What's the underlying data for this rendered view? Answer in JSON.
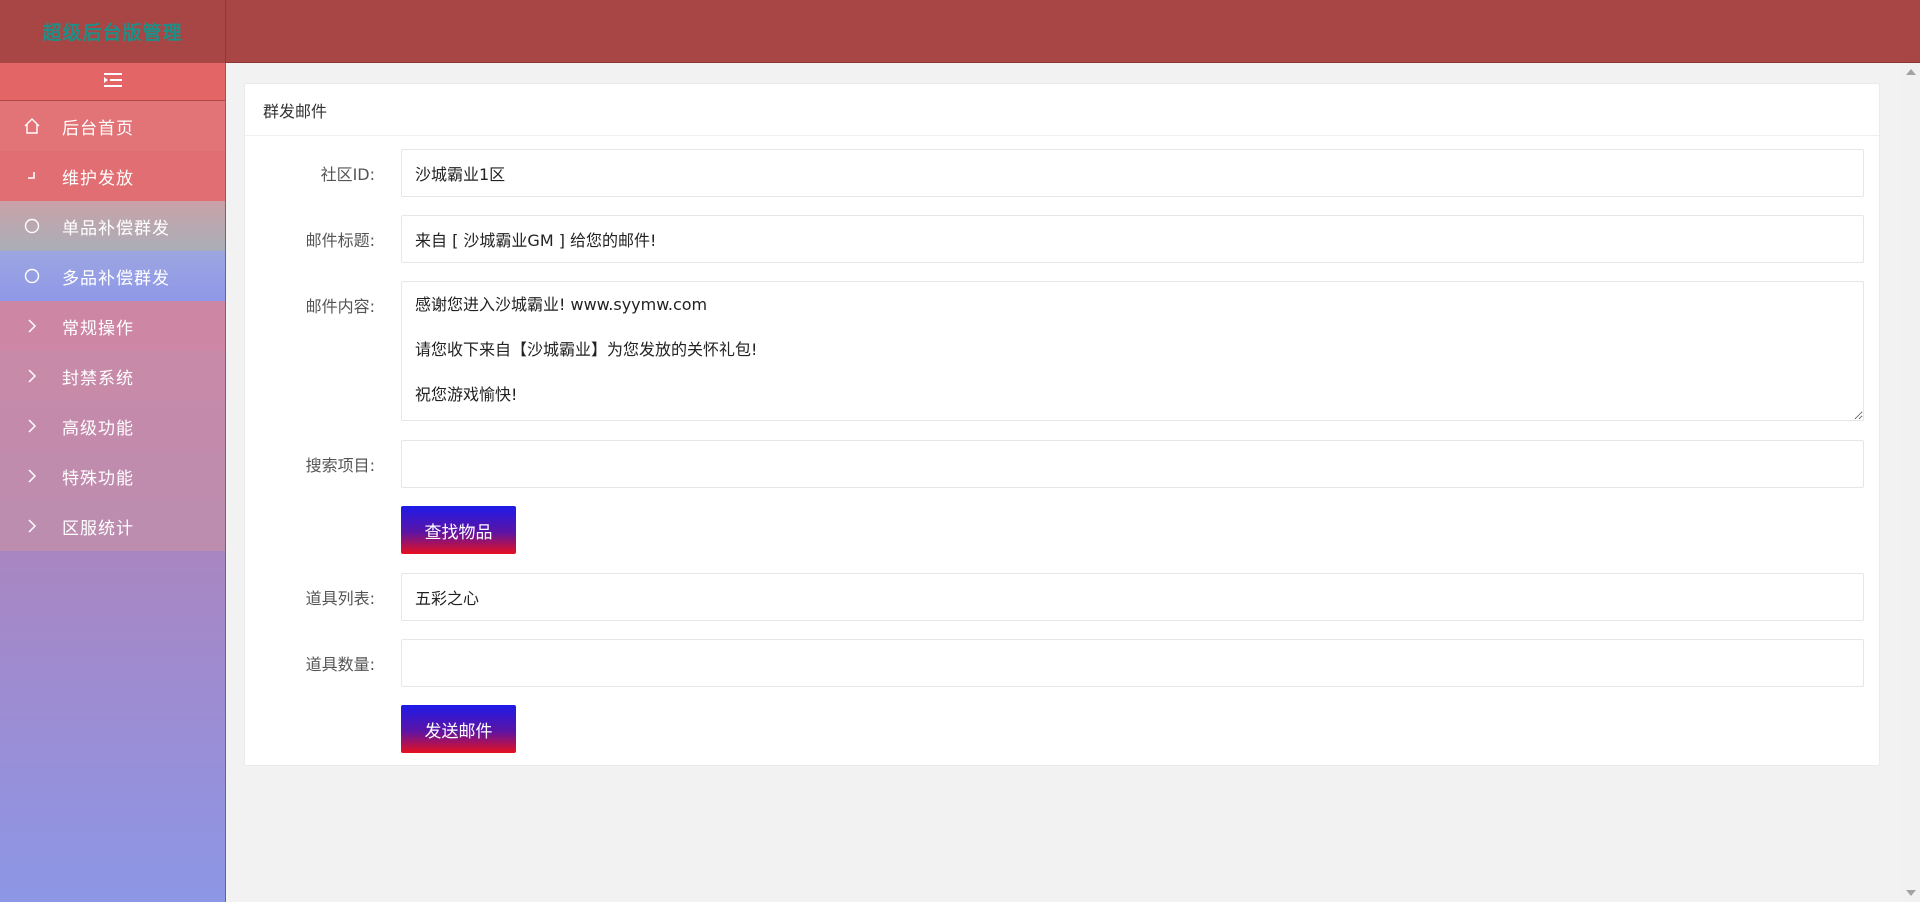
{
  "app": {
    "logo_text": "超级后台版管理"
  },
  "sidebar": {
    "toggle_icon": "menu-fold-icon",
    "items": [
      {
        "label": "后台首页",
        "icon": "home-icon"
      },
      {
        "label": "维护发放",
        "icon": "corner-icon"
      },
      {
        "label": "单品补偿群发",
        "icon": "circle-icon"
      },
      {
        "label": "多品补偿群发",
        "icon": "circle-icon"
      },
      {
        "label": "常规操作",
        "icon": "chevron-right-icon"
      },
      {
        "label": "封禁系统",
        "icon": "chevron-right-icon"
      },
      {
        "label": "高级功能",
        "icon": "chevron-right-icon"
      },
      {
        "label": "特殊功能",
        "icon": "chevron-right-icon"
      },
      {
        "label": "区服统计",
        "icon": "chevron-right-icon"
      }
    ]
  },
  "panel": {
    "title": "群发邮件",
    "fields": {
      "community_label": "社区ID:",
      "community_value": "沙城霸业1区",
      "mail_title_label": "邮件标题:",
      "mail_title_value": "来自 [ 沙城霸业GM ] 给您的邮件!",
      "mail_content_label": "邮件内容:",
      "mail_content_value": "感谢您进入沙城霸业! www.syymw.com\n请您收下来自【沙城霸业】为您发放的关怀礼包!\n祝您游戏愉快!",
      "search_label": "搜索项目:",
      "search_value": "",
      "find_button": "查找物品",
      "item_list_label": "道具列表:",
      "item_list_value": "五彩之心",
      "item_qty_label": "道具数量:",
      "item_qty_value": "",
      "send_button": "发送邮件"
    }
  },
  "colors": {
    "header": "#a84545",
    "toggle": "#e36565",
    "button_top": "#1d1ae9",
    "button_bottom": "#e8101e"
  }
}
